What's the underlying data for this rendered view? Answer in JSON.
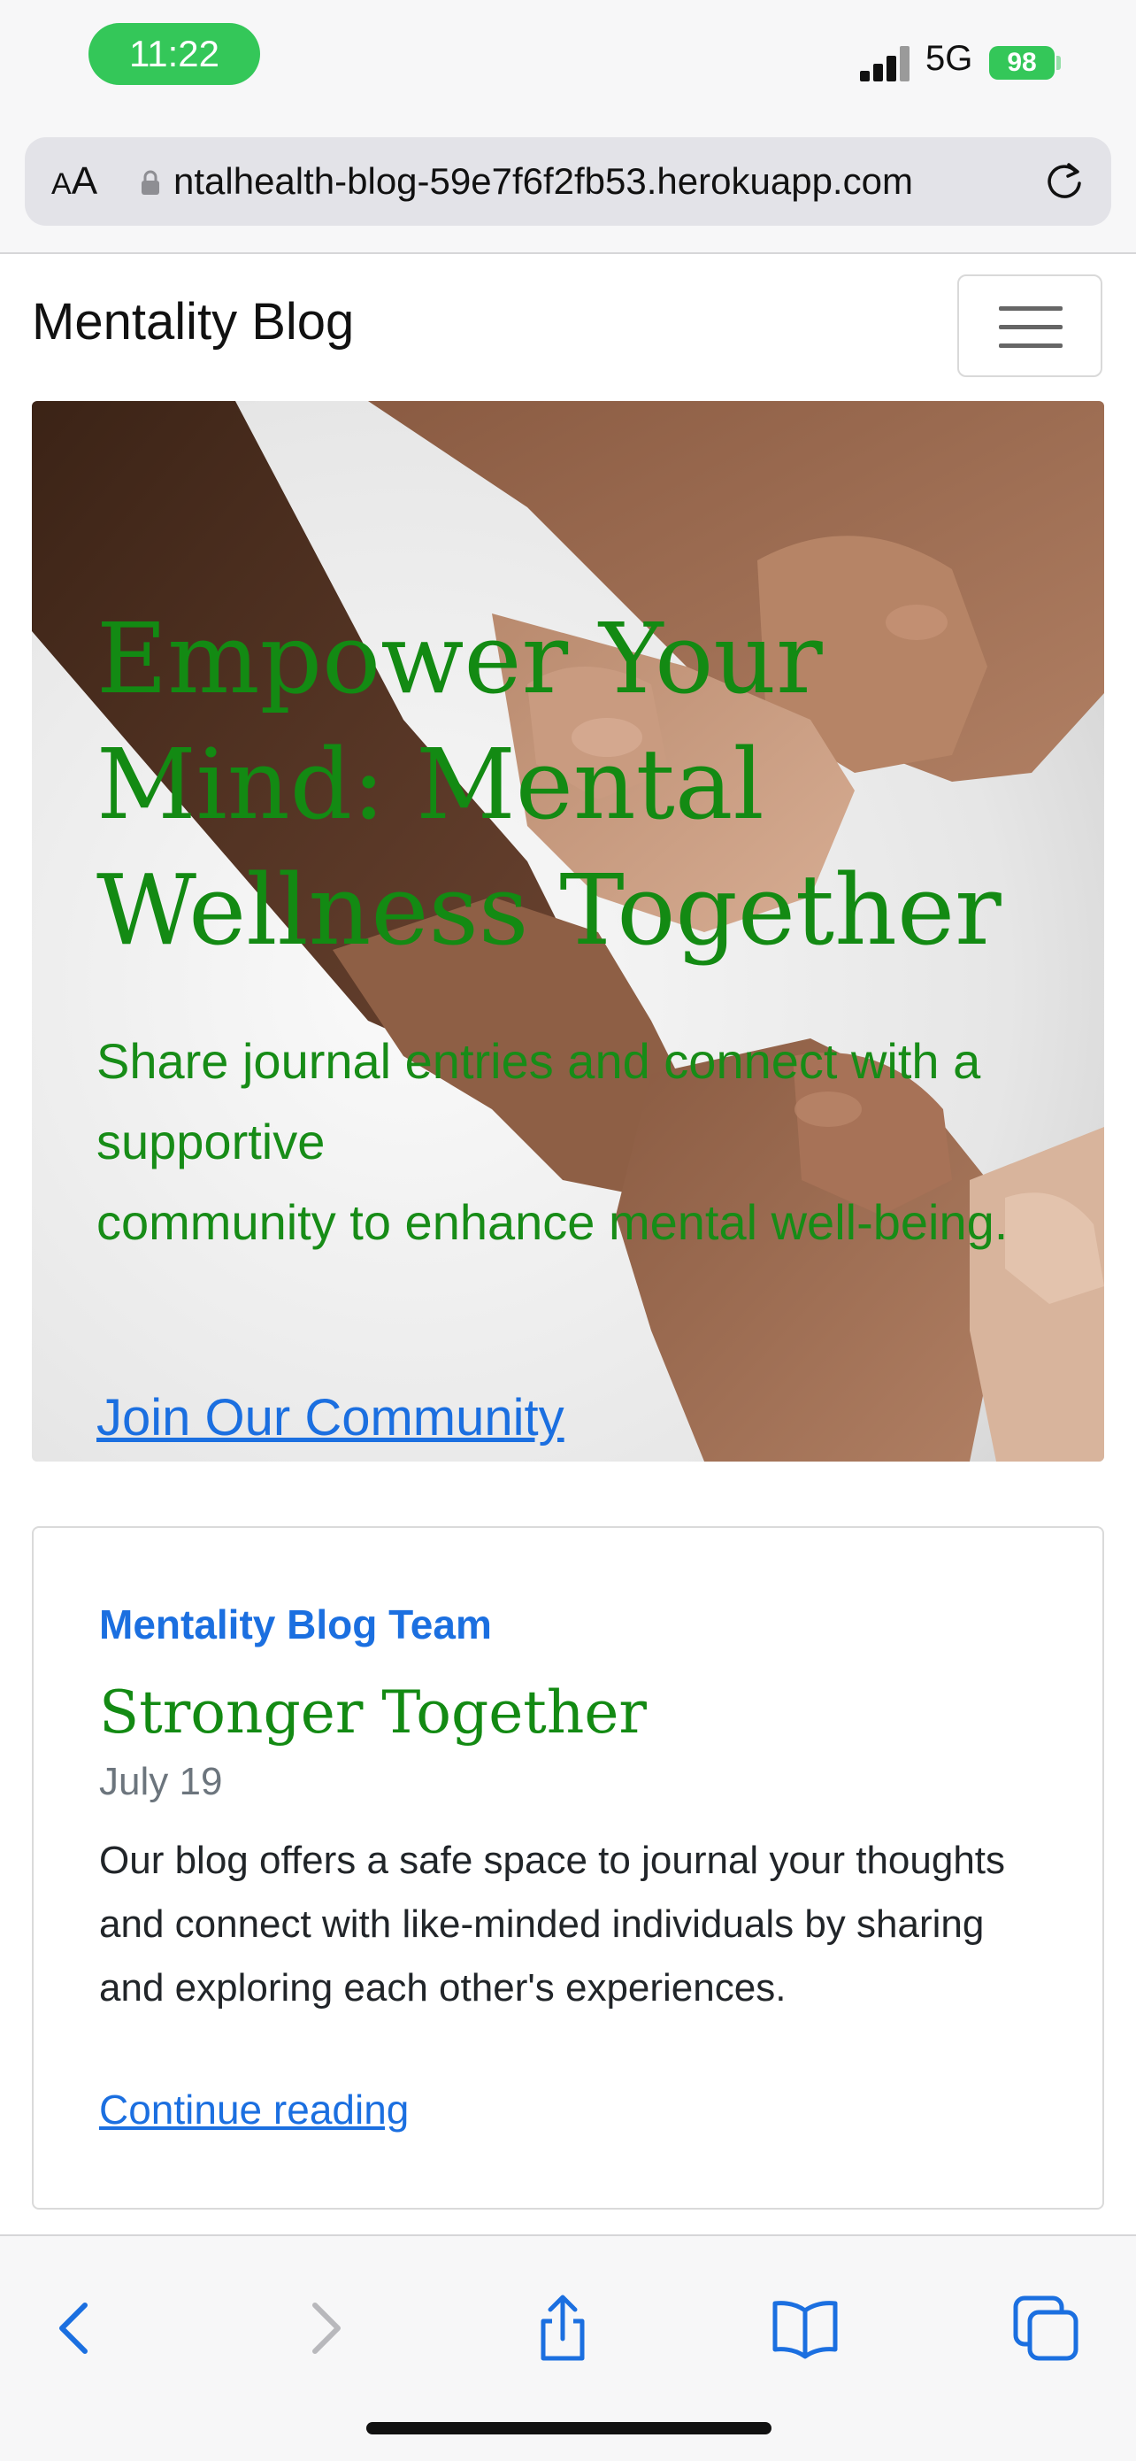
{
  "status_bar": {
    "time": "11:22",
    "network": "5G",
    "battery": "98",
    "time_pill_color": "#34c759"
  },
  "browser": {
    "text_size_label_small": "A",
    "text_size_label_large": "A",
    "url": "ntalhealth-blog-59e7f6f2fb53.herokuapp.com",
    "icons": [
      "lock-icon",
      "reload-icon",
      "back-icon",
      "forward-icon",
      "share-icon",
      "bookmarks-icon",
      "tabs-icon"
    ]
  },
  "navbar": {
    "brand": "Mentality Blog"
  },
  "hero": {
    "title": "Empower Your Mind: Mental Wellness Together",
    "subtitle_line1": "Share journal entries and connect with a supportive",
    "subtitle_line2": "community to enhance mental well-being.",
    "cta": "Join Our Community",
    "text_color": "#138a13",
    "link_color": "#1b6fe0"
  },
  "post": {
    "author": "Mentality Blog Team",
    "title": "Stronger Together",
    "date": "July 19",
    "excerpt": "Our blog offers a safe space to journal your thoughts and connect with like-minded individuals by sharing and exploring each other's experiences.",
    "link": "Continue reading"
  }
}
